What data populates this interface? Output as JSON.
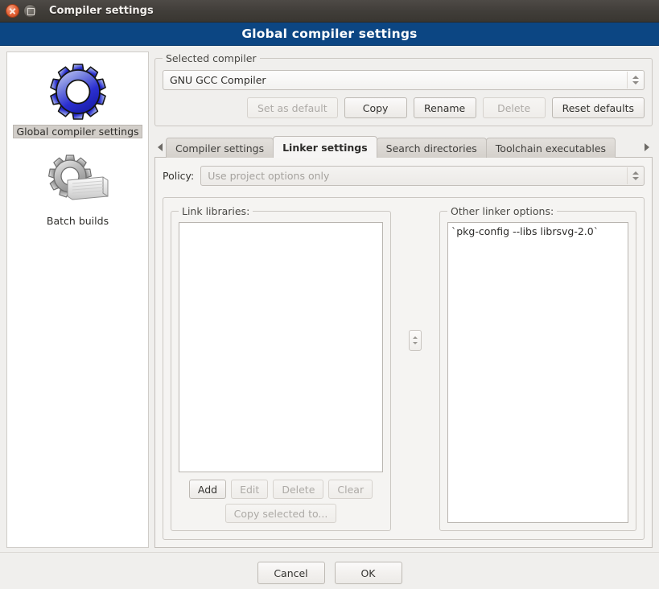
{
  "window": {
    "title": "Compiler settings",
    "close_icon": "close-icon",
    "maximize_icon": "maximize-icon",
    "header_title": "Global compiler settings"
  },
  "sidebar": {
    "items": [
      {
        "label": "Global compiler settings",
        "icon": "blue-gear-icon",
        "selected": true
      },
      {
        "label": "Batch builds",
        "icon": "grey-gear-pages-icon",
        "selected": false
      }
    ]
  },
  "selected_compiler": {
    "group_label": "Selected compiler",
    "value": "GNU GCC Compiler",
    "buttons": [
      {
        "label": "Set as default",
        "enabled": false
      },
      {
        "label": "Copy",
        "enabled": true
      },
      {
        "label": "Rename",
        "enabled": true
      },
      {
        "label": "Delete",
        "enabled": false
      },
      {
        "label": "Reset defaults",
        "enabled": true
      }
    ]
  },
  "tabs": {
    "scroll_left_icon": "chevron-left-icon",
    "scroll_right_icon": "chevron-right-icon",
    "items": [
      {
        "label": "Compiler settings",
        "active": false
      },
      {
        "label": "Linker settings",
        "active": true
      },
      {
        "label": "Search directories",
        "active": false
      },
      {
        "label": "Toolchain executables",
        "active": false
      }
    ]
  },
  "linker": {
    "policy_label": "Policy:",
    "policy_value": "Use project options only",
    "policy_enabled": false,
    "link_libraries": {
      "group_label": "Link libraries:",
      "entries": [],
      "buttons": [
        {
          "label": "Add",
          "enabled": true
        },
        {
          "label": "Edit",
          "enabled": false
        },
        {
          "label": "Delete",
          "enabled": false
        },
        {
          "label": "Clear",
          "enabled": false
        }
      ],
      "copy_button": {
        "label": "Copy selected to...",
        "enabled": false
      }
    },
    "reorder_spinner_icon": "up-down-spinner-icon",
    "other_options": {
      "group_label": "Other linker options:",
      "text": "`pkg-config --libs librsvg-2.0`"
    }
  },
  "footer": {
    "cancel_label": "Cancel",
    "ok_label": "OK"
  },
  "colors": {
    "header_blue": "#0c4683",
    "titlebar_dark": "#413e3a",
    "close_orange": "#e8663a",
    "panel_bg": "#f0efed",
    "tabpage_bg": "#f5f4f2"
  }
}
